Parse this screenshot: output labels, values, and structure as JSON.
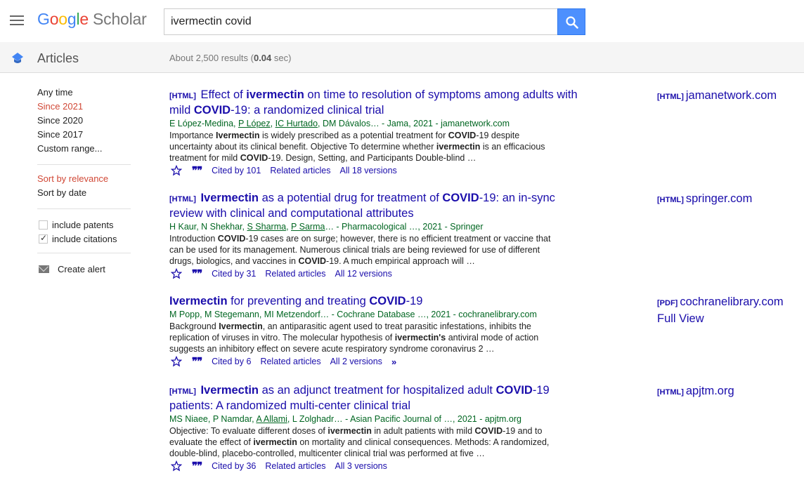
{
  "header": {
    "logo_g": "G",
    "logo_o1": "o",
    "logo_o2": "o",
    "logo_g2": "g",
    "logo_l": "l",
    "logo_e": "e",
    "logo_scholar": "Scholar",
    "search_value": "ivermectin covid"
  },
  "subheader": {
    "articles": "Articles",
    "results_prefix": "About 2,500 results (",
    "results_time": "0.04",
    "results_suffix": " sec)"
  },
  "sidebar": {
    "time_filters": [
      "Any time",
      "Since 2021",
      "Since 2020",
      "Since 2017",
      "Custom range..."
    ],
    "sort_options": [
      "Sort by relevance",
      "Sort by date"
    ],
    "include_patents": "include patents",
    "include_citations": "include citations",
    "create_alert": "Create alert"
  },
  "results": [
    {
      "tag": "[HTML]",
      "title_parts": [
        "Effect of ",
        "ivermectin",
        " on time to resolution of symptoms among adults with mild ",
        "COVID",
        "-19: a randomized clinical trial"
      ],
      "authors_parts": [
        "E López-Medina, ",
        "P López",
        ", ",
        "IC Hurtado",
        ", DM Dávalos… - Jama, 2021 - jamanetwork.com"
      ],
      "snippet_parts": [
        "Importance ",
        "Ivermectin",
        " is widely prescribed as a potential treatment for ",
        "COVID",
        "-19 despite uncertainty about its clinical benefit. Objective To determine whether ",
        "ivermectin",
        " is an efficacious treatment for mild ",
        "COVID",
        "-19. Design, Setting, and Participants Double-blind …"
      ],
      "cited_by": "Cited by 101",
      "related": "Related articles",
      "versions": "All 18 versions",
      "side_tag": "[HTML]",
      "side_link": "jamanetwork.com"
    },
    {
      "tag": "[HTML]",
      "title_parts": [
        "Ivermectin",
        " as a potential drug for treatment of ",
        "COVID",
        "-19: an in-sync review with clinical and computational attributes"
      ],
      "authors_parts": [
        "H Kaur, N Shekhar, ",
        "S Sharma",
        ", ",
        "P Sarma",
        "… - Pharmacological …, 2021 - Springer"
      ],
      "snippet_parts": [
        "Introduction ",
        "COVID",
        "-19 cases are on surge; however, there is no efficient treatment or vaccine that can be used for its management. Numerous clinical trials are being reviewed for use of different drugs, biologics, and vaccines in ",
        "COVID",
        "-19. A much empirical approach will …"
      ],
      "cited_by": "Cited by 31",
      "related": "Related articles",
      "versions": "All 12 versions",
      "side_tag": "[HTML]",
      "side_link": "springer.com"
    },
    {
      "tag": "",
      "title_parts": [
        "Ivermectin",
        " for preventing and treating ",
        "COVID",
        "-19"
      ],
      "authors_parts": [
        "M Popp, M Stegemann, MI Metzendorf… - Cochrane Database …, 2021 - cochranelibrary.com"
      ],
      "snippet_parts": [
        "Background ",
        "Ivermectin",
        ", an antiparasitic agent used to treat parasitic infestations, inhibits the replication of viruses in vitro. The molecular hypothesis of ",
        "ivermectin's",
        " antiviral mode of action suggests an inhibitory effect on severe acute respiratory syndrome coronavirus 2 …"
      ],
      "cited_by": "Cited by 6",
      "related": "Related articles",
      "versions": "All 2 versions",
      "side_tag": "[PDF]",
      "side_link": "cochranelibrary.com",
      "side_extra": "Full View"
    },
    {
      "tag": "[HTML]",
      "title_parts": [
        "Ivermectin",
        " as an adjunct treatment for hospitalized adult ",
        "COVID",
        "-19 patients: A randomized multi-center clinical trial"
      ],
      "authors_parts": [
        "MS Niaee, P Namdar, ",
        "A Allami",
        ", L Zolghadr… - Asian Pacific Journal of …, 2021 - apjtm.org"
      ],
      "snippet_parts": [
        "Objective: To evaluate different doses of ",
        "ivermectin",
        " in adult patients with mild ",
        "COVID",
        "-19 and to evaluate the effect of ",
        "ivermectin",
        " on mortality and clinical consequences. Methods: A randomized, double-blind, placebo-controlled, multicenter clinical trial was performed at five …"
      ],
      "cited_by": "Cited by 36",
      "related": "Related articles",
      "versions": "All 3 versions",
      "side_tag": "[HTML]",
      "side_link": "apjtm.org"
    }
  ],
  "colors": {
    "link": "#1a0dab",
    "authors": "#006621",
    "active": "#d14836",
    "search_button": "#4d90fe"
  }
}
